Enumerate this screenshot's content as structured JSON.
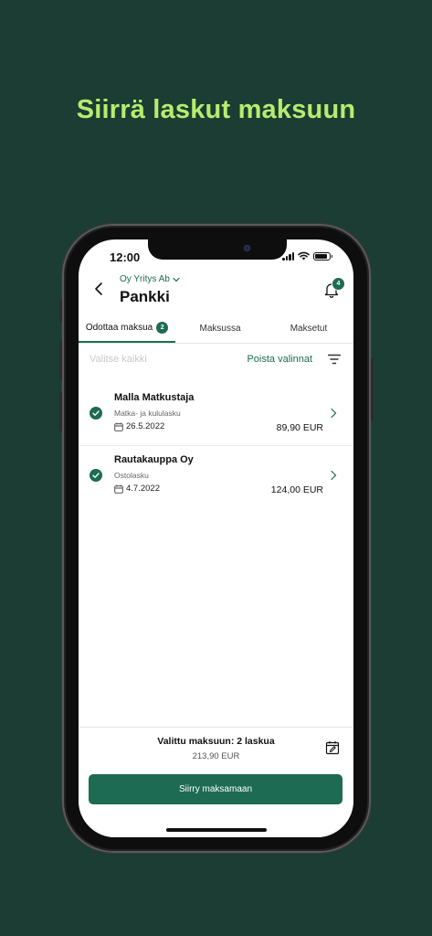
{
  "headline": "Siirrä laskut maksuun",
  "status_bar": {
    "time": "12:00"
  },
  "header": {
    "company": "Oy Yritys Ab",
    "title": "Pankki",
    "notification_count": "4"
  },
  "tabs": [
    {
      "label": "Odottaa maksua",
      "count": "2",
      "active": true
    },
    {
      "label": "Maksussa"
    },
    {
      "label": "Maksetut"
    }
  ],
  "toolbar": {
    "select_all": "Valitse kaikki",
    "clear_selection": "Poista valinnat"
  },
  "invoices": [
    {
      "name": "Malla Matkustaja",
      "type": "Matka- ja kululasku",
      "date": "26.5.2022",
      "amount": "89,90 EUR",
      "selected": true
    },
    {
      "name": "Rautakauppa Oy",
      "type": "Ostolasku",
      "date": "4.7.2022",
      "amount": "124,00 EUR",
      "selected": true
    }
  ],
  "footer": {
    "selected_summary": "Valittu maksuun: 2 laskua",
    "selected_total": "213,90 EUR",
    "cta_label": "Siirry maksamaan"
  },
  "colors": {
    "background": "#1b3d33",
    "headline": "#b6ec6e",
    "accent": "#1d6b52"
  },
  "icons": [
    "back-arrow-icon",
    "chevron-down-icon",
    "bell-icon",
    "filter-icon",
    "check-icon",
    "calendar-icon",
    "chevron-right-icon",
    "calendar-edit-icon",
    "signal-icon",
    "wifi-icon",
    "battery-icon"
  ]
}
